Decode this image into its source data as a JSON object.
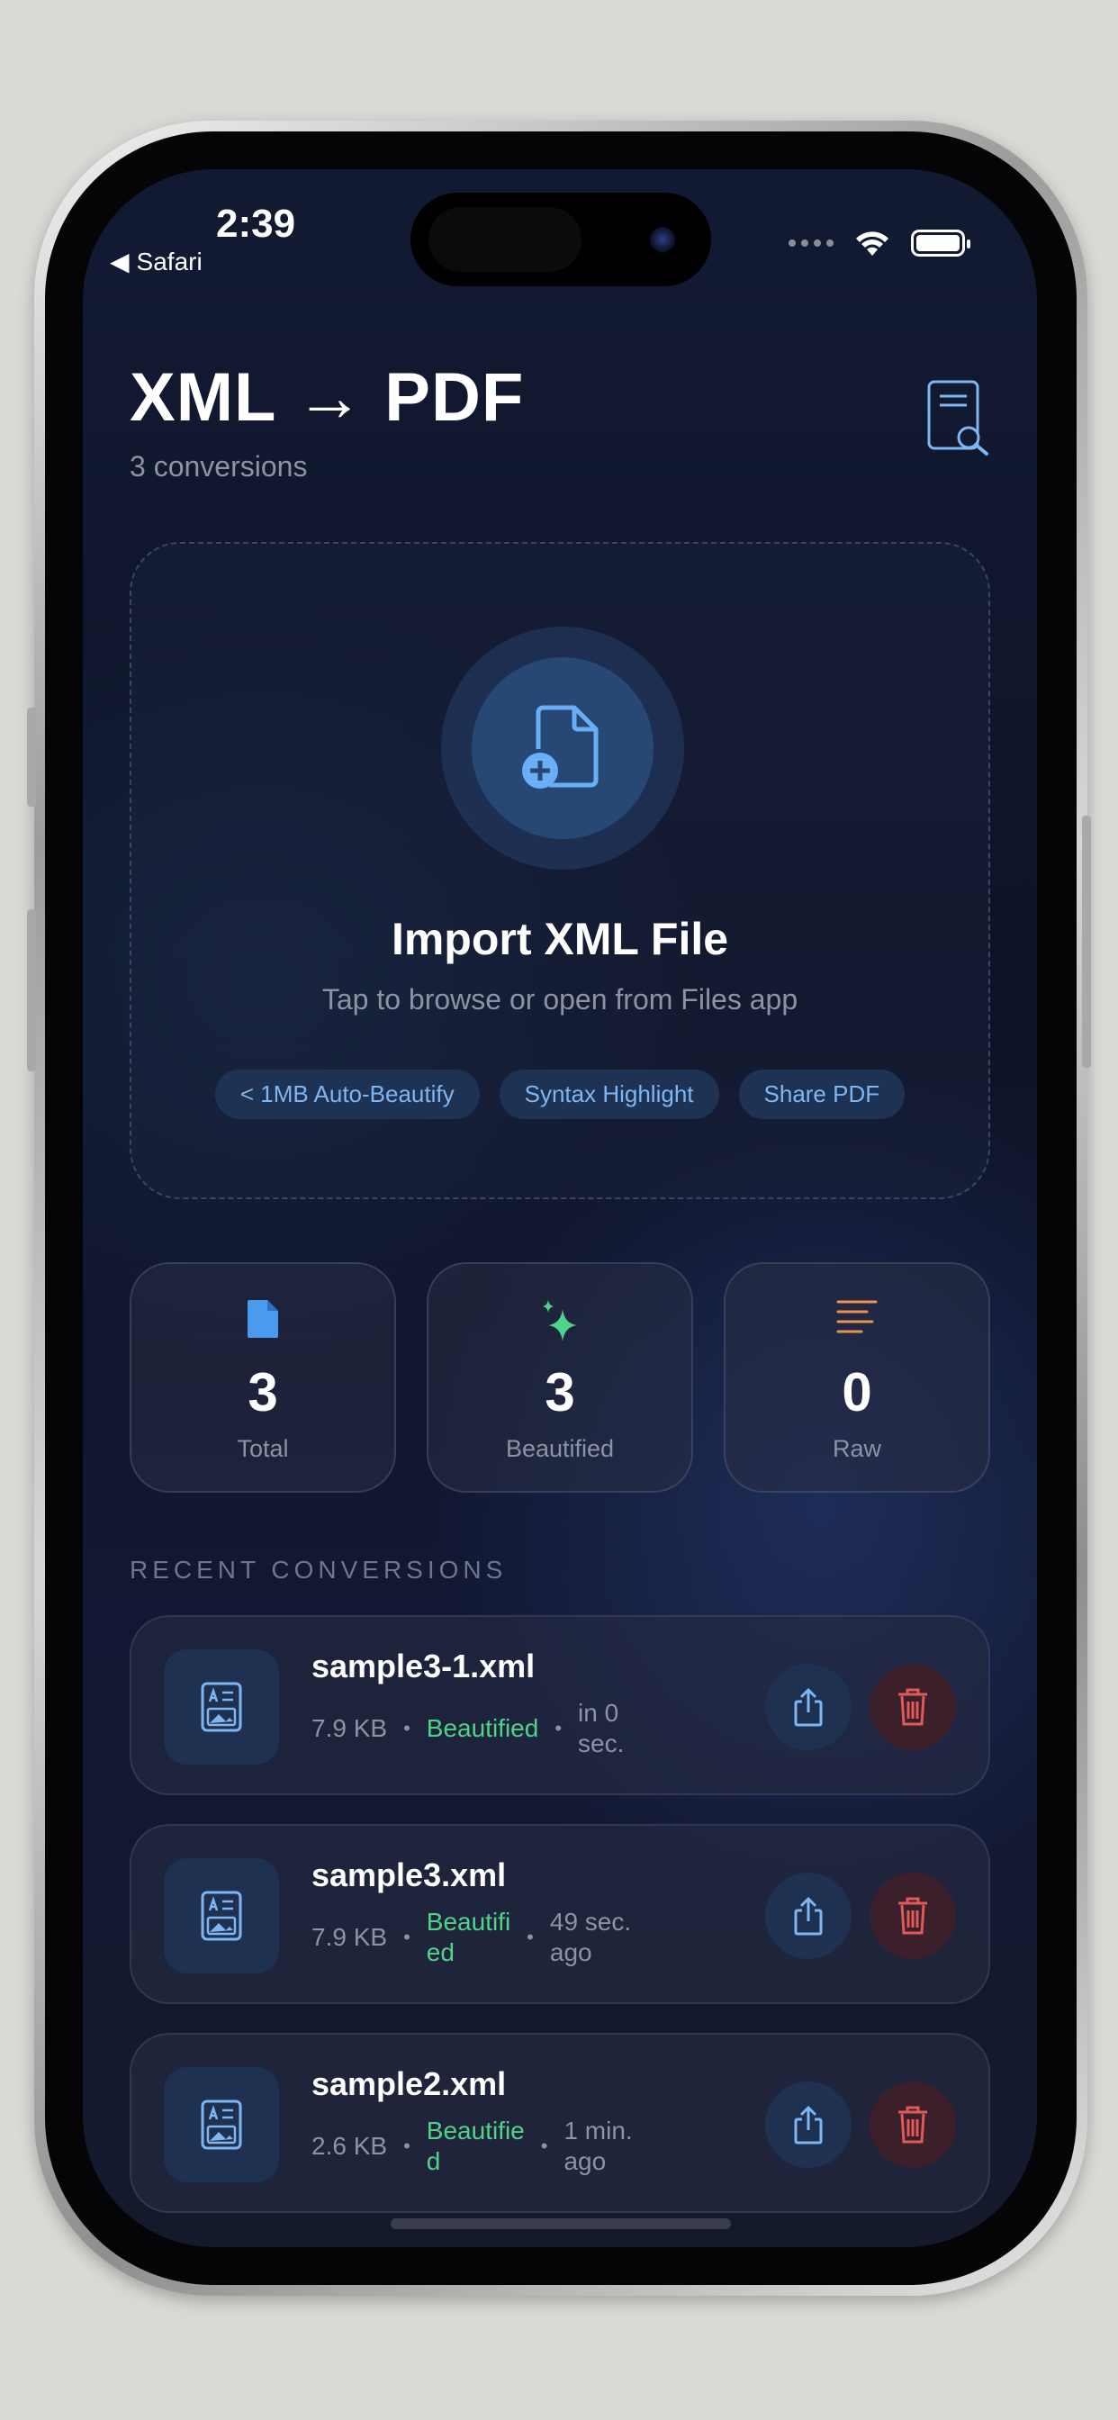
{
  "status_bar": {
    "time": "2:39",
    "back_app": "Safari"
  },
  "header": {
    "title": "XML → PDF",
    "subtitle": "3 conversions",
    "action_icon": "document-search-icon"
  },
  "import_card": {
    "icon": "document-add-icon",
    "title": "Import XML File",
    "subtitle": "Tap to browse or open from Files app",
    "chips": [
      "< 1MB Auto-Beautify",
      "Syntax Highlight",
      "Share PDF"
    ]
  },
  "stats": [
    {
      "icon": "document-fill-icon",
      "value": "3",
      "label": "Total",
      "color": "#4a9af0"
    },
    {
      "icon": "sparkles-icon",
      "value": "3",
      "label": "Beautified",
      "color": "#4fd28a"
    },
    {
      "icon": "text-lines-icon",
      "value": "0",
      "label": "Raw",
      "color": "#e8944a"
    }
  ],
  "recent": {
    "label": "RECENT CONVERSIONS",
    "items": [
      {
        "name": "sample3-1.xml",
        "size": "7.9 KB",
        "status": "Beautified",
        "time_line1": "in 0",
        "time_line2": "sec."
      },
      {
        "name": "sample3.xml",
        "size": "7.9 KB",
        "status_line1": "Beautifi",
        "status_line2": "ed",
        "time_line1": "49 sec.",
        "time_line2": "ago"
      },
      {
        "name": "sample2.xml",
        "size": "2.6 KB",
        "status_line1": "Beautifie",
        "status_line2": "d",
        "time_line1": "1 min.",
        "time_line2": "ago"
      }
    ]
  },
  "colors": {
    "accent_blue": "#4a9af0",
    "success_green": "#4fd28a",
    "danger_red": "#e05a5a",
    "raw_orange": "#e8944a"
  }
}
